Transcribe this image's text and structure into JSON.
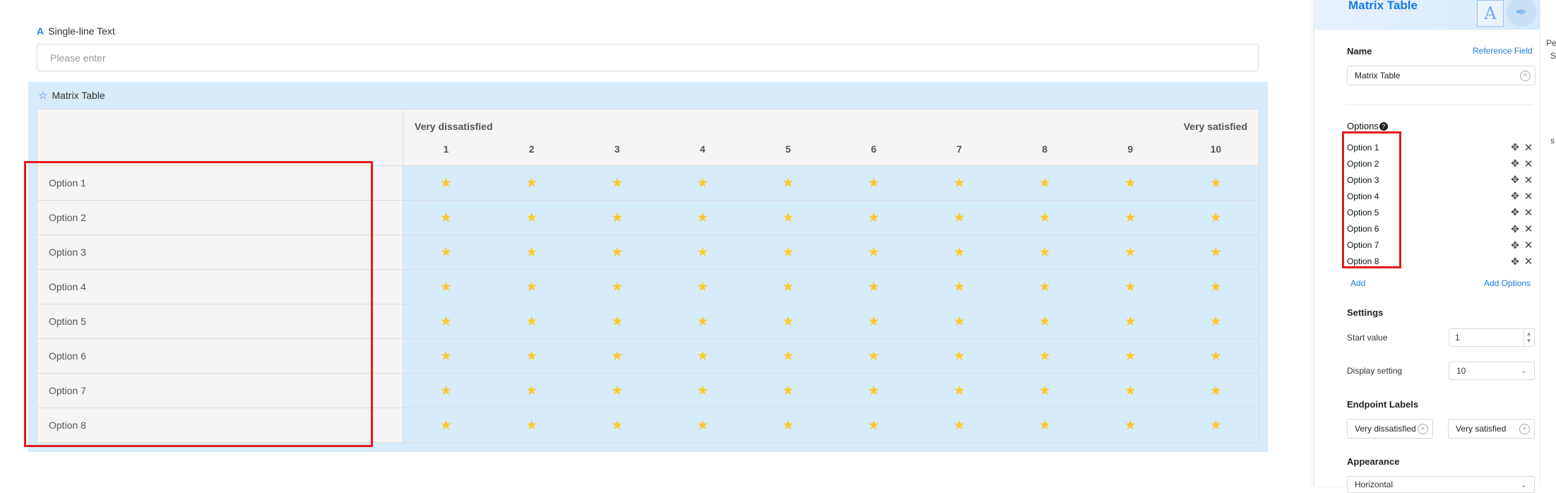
{
  "single_line": {
    "label": "Single-line Text",
    "label_icon": "A",
    "placeholder": "Please enter"
  },
  "matrix": {
    "label": "Matrix Table",
    "left_end": "Very dissatisfied",
    "right_end": "Very satisfied",
    "scale": [
      "1",
      "2",
      "3",
      "4",
      "5",
      "6",
      "7",
      "8",
      "9",
      "10"
    ],
    "rows": [
      "Option 1",
      "Option 2",
      "Option 3",
      "Option 4",
      "Option 5",
      "Option 6",
      "Option 7",
      "Option 8"
    ]
  },
  "panel": {
    "title": "Matrix Table",
    "deco_letter": "A",
    "name_label": "Name",
    "reference_field": "Reference Field",
    "name_value": "Matrix Table",
    "options_label": "Options",
    "options_hint": "?",
    "options": [
      "Option 1",
      "Option 2",
      "Option 3",
      "Option 4",
      "Option 5",
      "Option 6",
      "Option 7",
      "Option 8"
    ],
    "add": "Add",
    "add_options": "Add Options",
    "settings_label": "Settings",
    "start_value_label": "Start value",
    "start_value": "1",
    "display_setting_label": "Display setting",
    "display_setting": "10",
    "endpoint_labels": "Endpoint Labels",
    "endpoint_left": "Very dissatisfied",
    "endpoint_right": "Very satisfied",
    "appearance_label": "Appearance",
    "appearance_value": "Horizontal"
  },
  "peek": {
    "text1": "Pe",
    "text2": "S",
    "text3": "s"
  },
  "colors": {
    "accent": "#1a7ae0",
    "star": "#fbcb2c",
    "matrix_bg": "#d8ebfb",
    "highlight": "#e21b1b"
  }
}
